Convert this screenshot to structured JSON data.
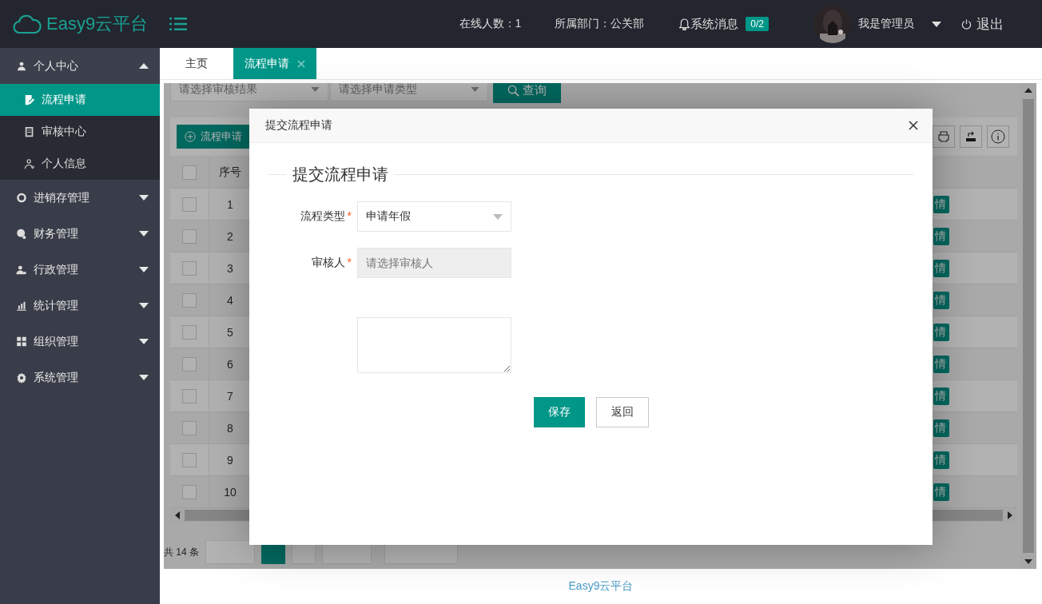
{
  "header": {
    "logo": "Easy9云平台",
    "online": "在线人数：1",
    "department": "所属部门：公关部",
    "messages": {
      "label": "系统消息",
      "badge": "0/2"
    },
    "user": "我是管理员",
    "logout": "退出"
  },
  "sidebar": [
    {
      "label": "个人中心",
      "expanded": true,
      "children": [
        {
          "label": "流程申请",
          "selected": true
        },
        {
          "label": "审核中心",
          "selected": false
        },
        {
          "label": "个人信息",
          "selected": false
        }
      ]
    },
    {
      "label": "进销存管理",
      "expanded": false
    },
    {
      "label": "财务管理",
      "expanded": false
    },
    {
      "label": "行政管理",
      "expanded": false
    },
    {
      "label": "统计管理",
      "expanded": false
    },
    {
      "label": "组织管理",
      "expanded": false
    },
    {
      "label": "系统管理",
      "expanded": false
    }
  ],
  "tabs": [
    {
      "label": "主页",
      "selected": false,
      "closable": false
    },
    {
      "label": "流程申请",
      "selected": true,
      "closable": true
    }
  ],
  "filters": [
    {
      "placeholder": "请选择审核结果"
    },
    {
      "placeholder": "请选择申请类型"
    }
  ],
  "search_button": "查询",
  "toolbar": {
    "add_button": "流程申请"
  },
  "table": {
    "header_checked": false,
    "columns": [
      "序号"
    ],
    "rows": [
      {
        "index": "1",
        "checked": false,
        "action": "情"
      },
      {
        "index": "2",
        "checked": false,
        "action": "情"
      },
      {
        "index": "3",
        "checked": false,
        "action": "情"
      },
      {
        "index": "4",
        "checked": false,
        "action": "情"
      },
      {
        "index": "5",
        "checked": false,
        "action": "情"
      },
      {
        "index": "6",
        "checked": false,
        "action": "情"
      },
      {
        "index": "7",
        "checked": false,
        "action": "情"
      },
      {
        "index": "8",
        "checked": false,
        "action": "情"
      },
      {
        "index": "9",
        "checked": false,
        "action": "情"
      },
      {
        "index": "10",
        "checked": false,
        "action": "情"
      }
    ]
  },
  "pagination": {
    "total": "共 14 条"
  },
  "dialog": {
    "title": "提交流程申请",
    "legend": "提交流程申请",
    "fields": [
      {
        "kind": "select",
        "label": "流程类型",
        "required_mark": "*",
        "value": "申请年假"
      },
      {
        "kind": "input",
        "label": "审核人",
        "required_mark": "*",
        "placeholder": "请选择审核人",
        "disabled": true
      },
      {
        "kind": "textarea"
      }
    ],
    "buttons": [
      {
        "label": "保存",
        "primary": true
      },
      {
        "label": "返回",
        "primary": false
      }
    ]
  },
  "footer": "Easy9云平台"
}
